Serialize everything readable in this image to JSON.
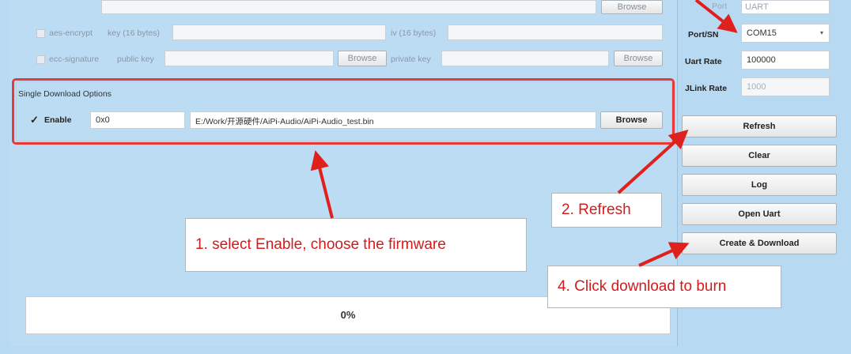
{
  "top_row": {
    "browse_label": "Browse",
    "right_label": "Port",
    "right_value": "UART"
  },
  "aes": {
    "checkbox_label": "aes-encrypt",
    "key_label": "key (16 bytes)",
    "iv_label": "iv (16 bytes)"
  },
  "ecc": {
    "checkbox_label": "ecc-signature",
    "public_key_label": "public key",
    "browse_label": "Browse",
    "private_key_label": "private key",
    "browse2_label": "Browse"
  },
  "single_download": {
    "group_title": "Single Download Options",
    "check_mark": "✓",
    "enable_label": "Enable",
    "address_value": "0x0",
    "file_path": "E:/Work/开源硬件/AiPi-Audio/AiPi-Audio_test.bin",
    "browse_label": "Browse"
  },
  "settings": {
    "port_label": "Port/SN",
    "port_value": "COM15",
    "uart_rate_label": "Uart Rate",
    "uart_rate_value": "100000",
    "jlink_rate_label": "JLink Rate",
    "jlink_rate_value": "1000"
  },
  "actions": {
    "refresh": "Refresh",
    "clear": "Clear",
    "log": "Log",
    "open_uart": "Open Uart",
    "create_download": "Create & Download"
  },
  "progress": {
    "text": "0%",
    "fraction": 0
  },
  "annotations": {
    "step1": "1. select Enable, choose the firmware",
    "step2": "2. Refresh",
    "step4": "4. Click  download to burn"
  },
  "colors": {
    "highlight": "#e53a3a",
    "arrow": "#e0201c",
    "note_text": "#d21c1c",
    "background": "#b8d9f2"
  }
}
